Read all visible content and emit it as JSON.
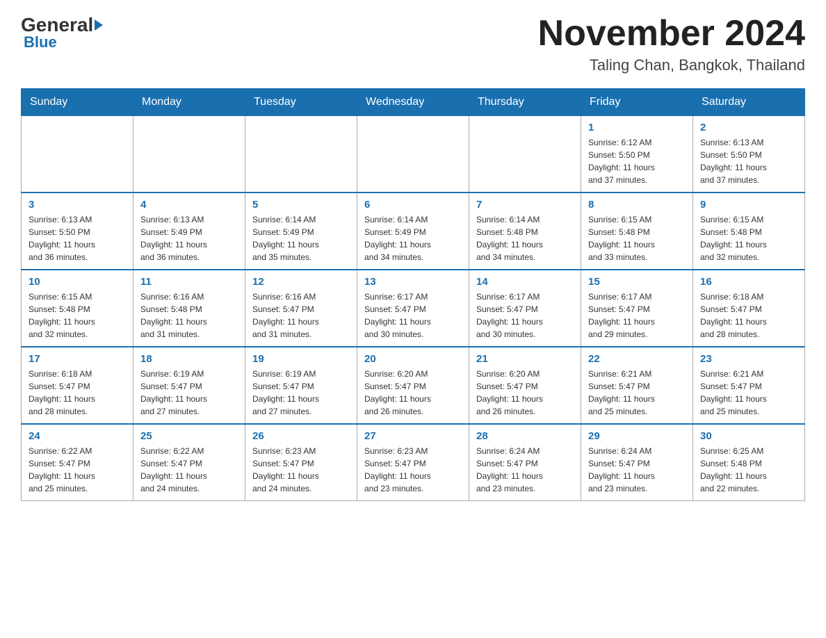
{
  "header": {
    "logo_general": "General",
    "logo_blue": "Blue",
    "month_title": "November 2024",
    "location": "Taling Chan, Bangkok, Thailand"
  },
  "days_of_week": [
    "Sunday",
    "Monday",
    "Tuesday",
    "Wednesday",
    "Thursday",
    "Friday",
    "Saturday"
  ],
  "weeks": [
    {
      "days": [
        {
          "num": "",
          "info": ""
        },
        {
          "num": "",
          "info": ""
        },
        {
          "num": "",
          "info": ""
        },
        {
          "num": "",
          "info": ""
        },
        {
          "num": "",
          "info": ""
        },
        {
          "num": "1",
          "info": "Sunrise: 6:12 AM\nSunset: 5:50 PM\nDaylight: 11 hours\nand 37 minutes."
        },
        {
          "num": "2",
          "info": "Sunrise: 6:13 AM\nSunset: 5:50 PM\nDaylight: 11 hours\nand 37 minutes."
        }
      ]
    },
    {
      "days": [
        {
          "num": "3",
          "info": "Sunrise: 6:13 AM\nSunset: 5:50 PM\nDaylight: 11 hours\nand 36 minutes."
        },
        {
          "num": "4",
          "info": "Sunrise: 6:13 AM\nSunset: 5:49 PM\nDaylight: 11 hours\nand 36 minutes."
        },
        {
          "num": "5",
          "info": "Sunrise: 6:14 AM\nSunset: 5:49 PM\nDaylight: 11 hours\nand 35 minutes."
        },
        {
          "num": "6",
          "info": "Sunrise: 6:14 AM\nSunset: 5:49 PM\nDaylight: 11 hours\nand 34 minutes."
        },
        {
          "num": "7",
          "info": "Sunrise: 6:14 AM\nSunset: 5:48 PM\nDaylight: 11 hours\nand 34 minutes."
        },
        {
          "num": "8",
          "info": "Sunrise: 6:15 AM\nSunset: 5:48 PM\nDaylight: 11 hours\nand 33 minutes."
        },
        {
          "num": "9",
          "info": "Sunrise: 6:15 AM\nSunset: 5:48 PM\nDaylight: 11 hours\nand 32 minutes."
        }
      ]
    },
    {
      "days": [
        {
          "num": "10",
          "info": "Sunrise: 6:15 AM\nSunset: 5:48 PM\nDaylight: 11 hours\nand 32 minutes."
        },
        {
          "num": "11",
          "info": "Sunrise: 6:16 AM\nSunset: 5:48 PM\nDaylight: 11 hours\nand 31 minutes."
        },
        {
          "num": "12",
          "info": "Sunrise: 6:16 AM\nSunset: 5:47 PM\nDaylight: 11 hours\nand 31 minutes."
        },
        {
          "num": "13",
          "info": "Sunrise: 6:17 AM\nSunset: 5:47 PM\nDaylight: 11 hours\nand 30 minutes."
        },
        {
          "num": "14",
          "info": "Sunrise: 6:17 AM\nSunset: 5:47 PM\nDaylight: 11 hours\nand 30 minutes."
        },
        {
          "num": "15",
          "info": "Sunrise: 6:17 AM\nSunset: 5:47 PM\nDaylight: 11 hours\nand 29 minutes."
        },
        {
          "num": "16",
          "info": "Sunrise: 6:18 AM\nSunset: 5:47 PM\nDaylight: 11 hours\nand 28 minutes."
        }
      ]
    },
    {
      "days": [
        {
          "num": "17",
          "info": "Sunrise: 6:18 AM\nSunset: 5:47 PM\nDaylight: 11 hours\nand 28 minutes."
        },
        {
          "num": "18",
          "info": "Sunrise: 6:19 AM\nSunset: 5:47 PM\nDaylight: 11 hours\nand 27 minutes."
        },
        {
          "num": "19",
          "info": "Sunrise: 6:19 AM\nSunset: 5:47 PM\nDaylight: 11 hours\nand 27 minutes."
        },
        {
          "num": "20",
          "info": "Sunrise: 6:20 AM\nSunset: 5:47 PM\nDaylight: 11 hours\nand 26 minutes."
        },
        {
          "num": "21",
          "info": "Sunrise: 6:20 AM\nSunset: 5:47 PM\nDaylight: 11 hours\nand 26 minutes."
        },
        {
          "num": "22",
          "info": "Sunrise: 6:21 AM\nSunset: 5:47 PM\nDaylight: 11 hours\nand 25 minutes."
        },
        {
          "num": "23",
          "info": "Sunrise: 6:21 AM\nSunset: 5:47 PM\nDaylight: 11 hours\nand 25 minutes."
        }
      ]
    },
    {
      "days": [
        {
          "num": "24",
          "info": "Sunrise: 6:22 AM\nSunset: 5:47 PM\nDaylight: 11 hours\nand 25 minutes."
        },
        {
          "num": "25",
          "info": "Sunrise: 6:22 AM\nSunset: 5:47 PM\nDaylight: 11 hours\nand 24 minutes."
        },
        {
          "num": "26",
          "info": "Sunrise: 6:23 AM\nSunset: 5:47 PM\nDaylight: 11 hours\nand 24 minutes."
        },
        {
          "num": "27",
          "info": "Sunrise: 6:23 AM\nSunset: 5:47 PM\nDaylight: 11 hours\nand 23 minutes."
        },
        {
          "num": "28",
          "info": "Sunrise: 6:24 AM\nSunset: 5:47 PM\nDaylight: 11 hours\nand 23 minutes."
        },
        {
          "num": "29",
          "info": "Sunrise: 6:24 AM\nSunset: 5:47 PM\nDaylight: 11 hours\nand 23 minutes."
        },
        {
          "num": "30",
          "info": "Sunrise: 6:25 AM\nSunset: 5:48 PM\nDaylight: 11 hours\nand 22 minutes."
        }
      ]
    }
  ]
}
